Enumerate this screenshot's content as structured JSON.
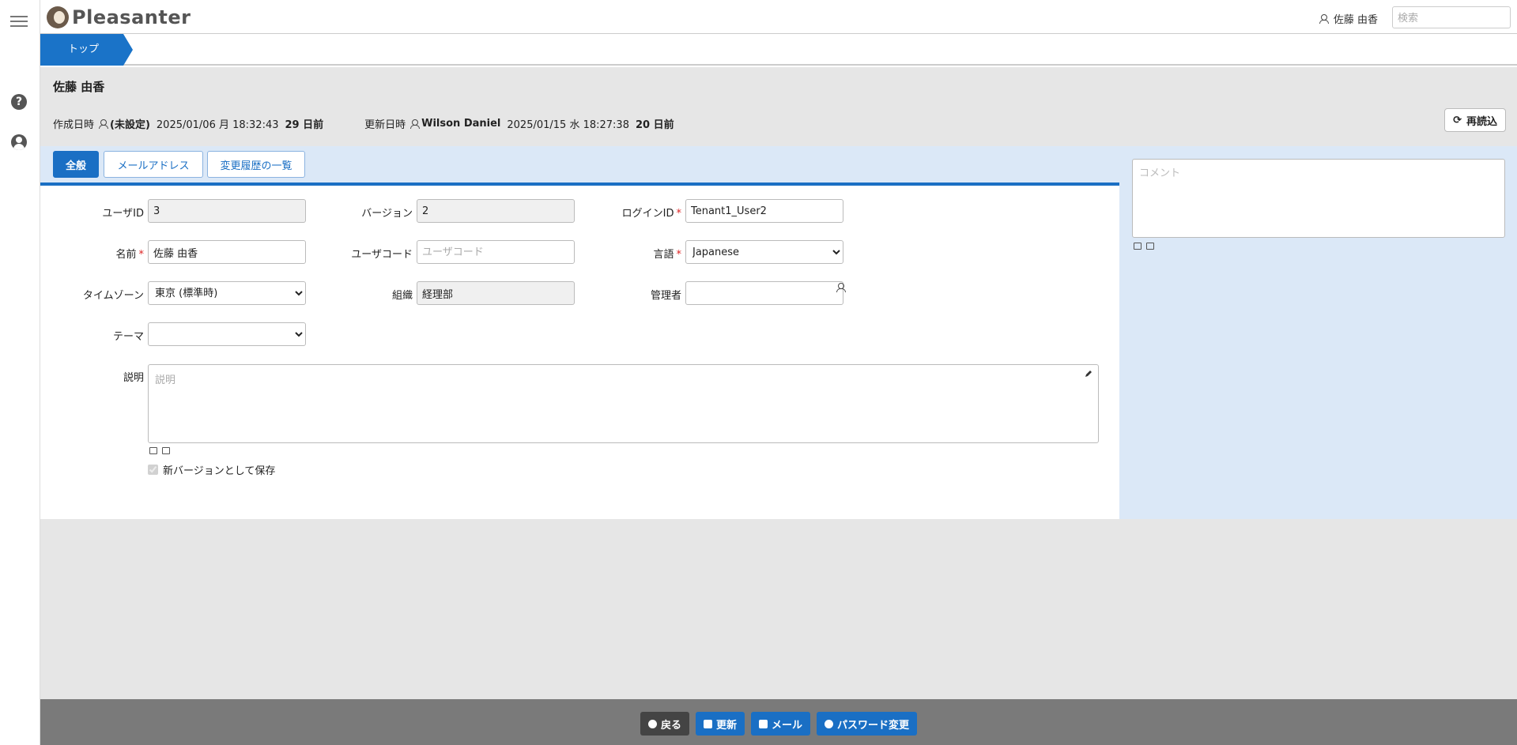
{
  "app": {
    "logo_text": "Pleasanter"
  },
  "header": {
    "user_name": "佐藤 由香",
    "search_placeholder": "検索"
  },
  "breadcrumb": {
    "top": "トップ"
  },
  "record": {
    "title": "佐藤 由香",
    "created_label": "作成日時",
    "created_by": "(未設定)",
    "created_at": "2025/01/06 月 18:32:43",
    "created_ago": "29 日前",
    "updated_label": "更新日時",
    "updated_by": "Wilson Daniel",
    "updated_at": "2025/01/15 水 18:27:38",
    "updated_ago": "20 日前",
    "reload_label": "再読込"
  },
  "tabs": [
    {
      "label": "全般",
      "active": true
    },
    {
      "label": "メールアドレス",
      "active": false
    },
    {
      "label": "変更履歴の一覧",
      "active": false
    }
  ],
  "form": {
    "user_id": {
      "label": "ユーザID",
      "value": "3"
    },
    "version": {
      "label": "バージョン",
      "value": "2"
    },
    "login_id": {
      "label": "ログインID",
      "value": "Tenant1_User2"
    },
    "name": {
      "label": "名前",
      "value": "佐藤 由香"
    },
    "user_code": {
      "label": "ユーザコード",
      "placeholder": "ユーザコード"
    },
    "language": {
      "label": "言語",
      "value": "Japanese"
    },
    "timezone": {
      "label": "タイムゾーン",
      "value": "東京 (標準時)"
    },
    "organization": {
      "label": "組織",
      "value": "経理部"
    },
    "manager": {
      "label": "管理者",
      "value": ""
    },
    "theme": {
      "label": "テーマ",
      "value": ""
    },
    "description": {
      "label": "説明",
      "placeholder": "説明"
    },
    "save_new_version": {
      "label": "新バージョンとして保存",
      "checked": true
    }
  },
  "comment": {
    "placeholder": "コメント"
  },
  "footer": {
    "back": "戻る",
    "update": "更新",
    "mail": "メール",
    "change_password": "パスワード変更"
  },
  "colors": {
    "accent": "#1a6fc4",
    "panel": "#dbe8f7",
    "background": "#e6e6e6",
    "footer": "#7a7a7a"
  }
}
